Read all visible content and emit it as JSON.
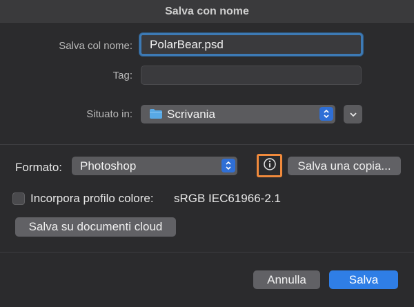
{
  "dialog": {
    "title": "Salva con nome"
  },
  "save_as": {
    "label": "Salva col nome:",
    "value": "PolarBear.psd"
  },
  "tags": {
    "label": "Tag:",
    "value": ""
  },
  "location": {
    "label": "Situato in:",
    "value": "Scrivania"
  },
  "format": {
    "label": "Formato:",
    "value": "Photoshop",
    "save_copy_label": "Salva una copia..."
  },
  "embed_profile": {
    "label": "Incorpora profilo colore:",
    "value": "sRGB IEC61966-2.1",
    "checked": false
  },
  "cloud": {
    "label": "Salva su documenti cloud"
  },
  "footer": {
    "cancel_label": "Annulla",
    "save_label": "Salva"
  },
  "colors": {
    "accent": "#2f7ee6",
    "focus_ring": "#3d7ab5",
    "highlight": "#f08a3c"
  }
}
